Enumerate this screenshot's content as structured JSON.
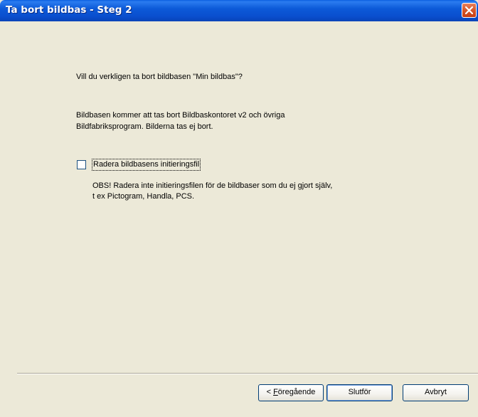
{
  "window": {
    "title": "Ta bort bildbas - Steg 2"
  },
  "content": {
    "question": "Vill du verkligen ta bort bildbasen \"Min bildbas\"?",
    "info_line1": "Bildbasen kommer att tas bort Bildbaskontoret v2 och övriga",
    "info_line2": "Bildfabriksprogram. Bilderna tas ej bort.",
    "checkbox_label": "Radera bildbasens initieringsfil",
    "checkbox_checked": false,
    "note_line1": "OBS! Radera inte initieringsfilen för de bildbaser som du ej gjort själv,",
    "note_line2": "t ex Pictogram, Handla, PCS."
  },
  "buttons": {
    "back_prefix": "< ",
    "back_accel": "F",
    "back_rest": "öregående",
    "finish": "Slutför",
    "cancel": "Avbryt"
  },
  "icons": {
    "close": "close-icon"
  },
  "colors": {
    "dialog_bg": "#ece9d8",
    "titlebar": "#0a5fe0",
    "close_button": "#d85a2c"
  }
}
